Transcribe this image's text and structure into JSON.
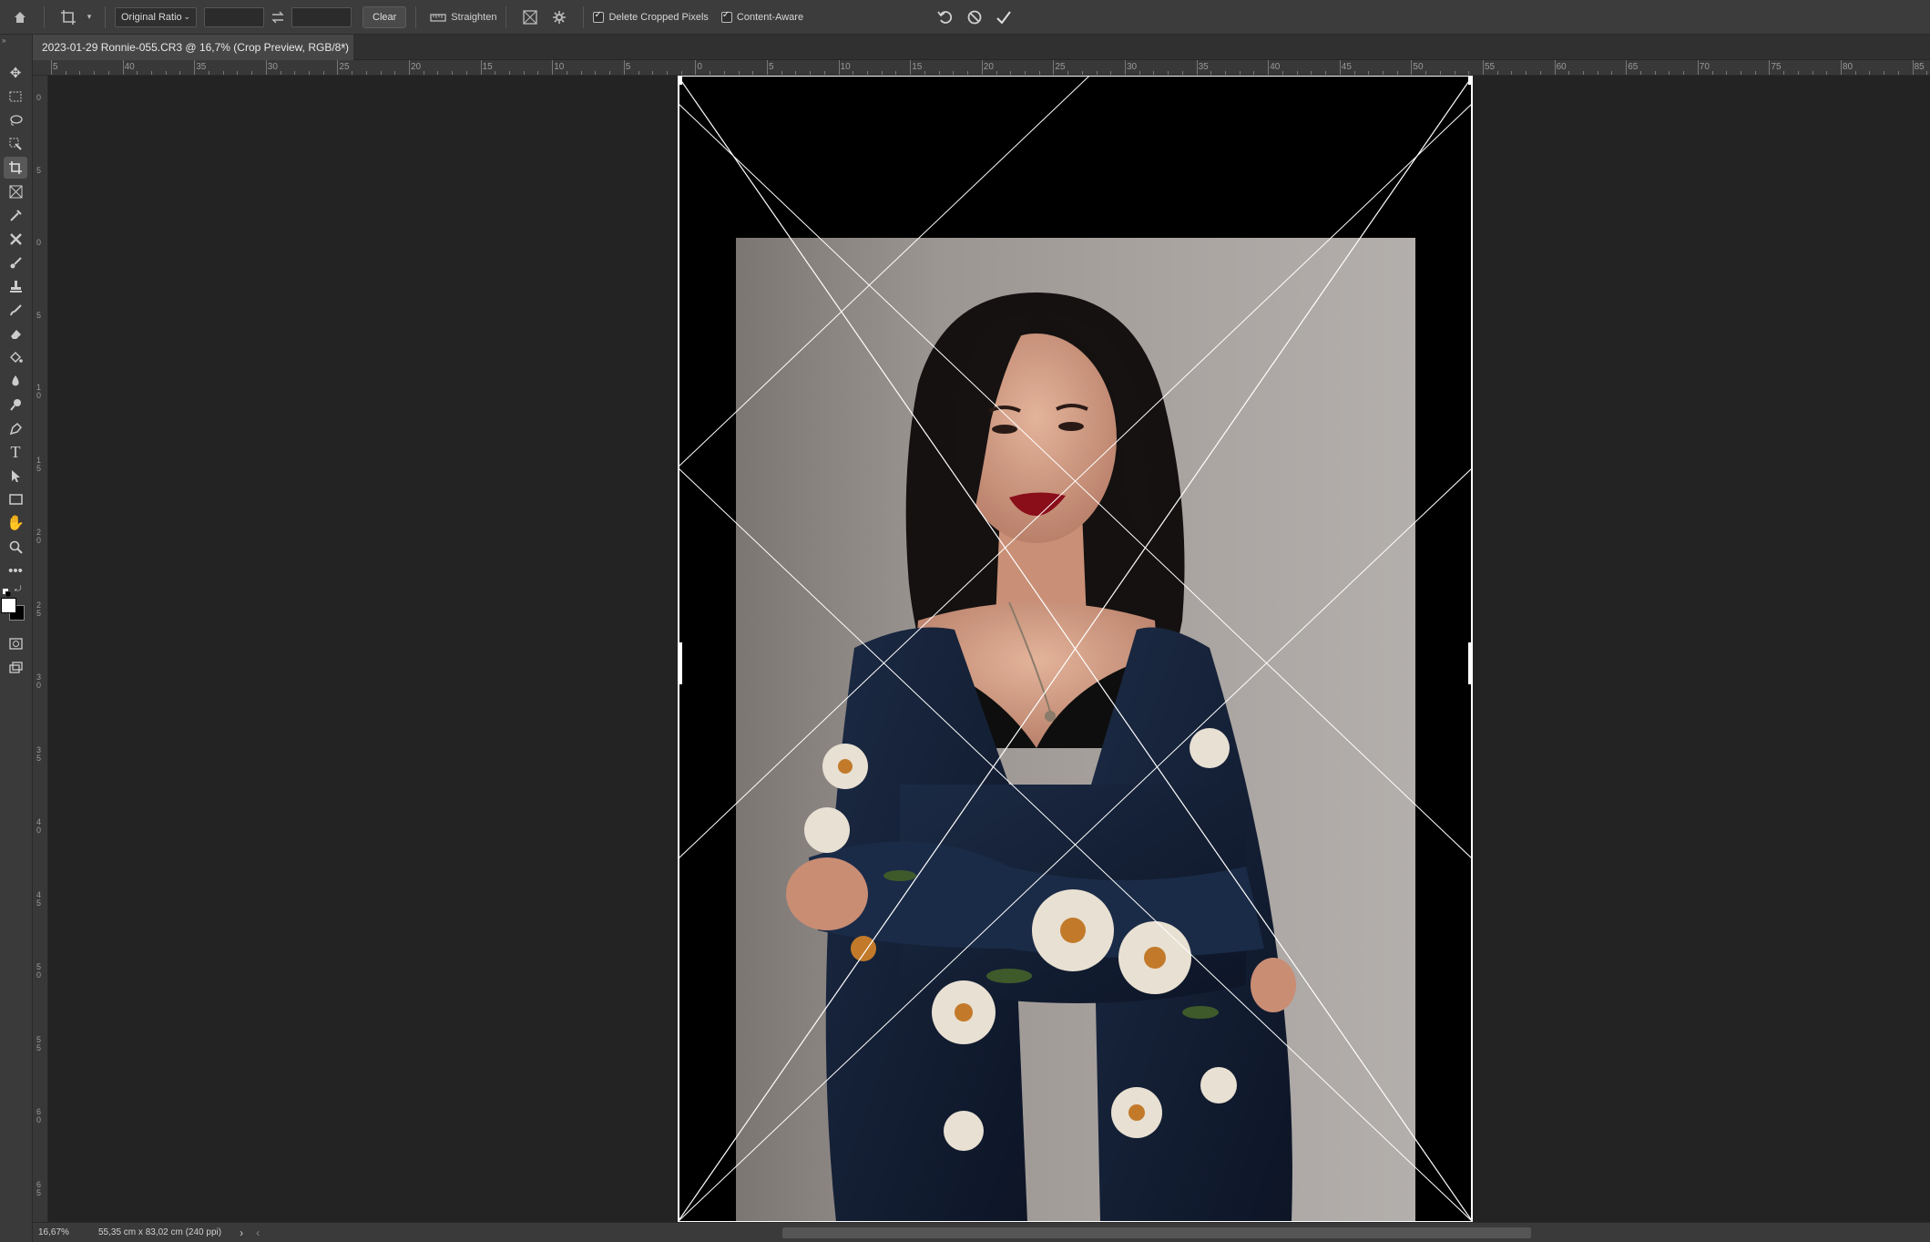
{
  "options_bar": {
    "ratio_preset": "Original Ratio",
    "width_value": "",
    "height_value": "",
    "clear_label": "Clear",
    "straighten_label": "Straighten",
    "delete_cropped_label": "Delete Cropped Pixels",
    "content_aware_label": "Content-Aware",
    "delete_cropped_checked": true,
    "content_aware_checked": true
  },
  "document_tab": {
    "title": "2023-01-29 Ronnie-055.CR3 @ 16,7% (Crop Preview, RGB/8*)",
    "close_glyph": "×"
  },
  "ruler_h": {
    "labels": [
      "5",
      "40",
      "35",
      "30",
      "25",
      "20",
      "15",
      "10",
      "5",
      "0",
      "5",
      "10",
      "15",
      "20",
      "25",
      "30",
      "35",
      "40",
      "45",
      "50",
      "55",
      "60",
      "65",
      "70",
      "75",
      "80",
      "85"
    ]
  },
  "ruler_v": {
    "labels": [
      "0",
      "5",
      "0",
      "5",
      "1 0",
      "1 5",
      "2 0",
      "2 5",
      "3 0",
      "3 5",
      "4 0",
      "4 5",
      "5 0",
      "5 5",
      "6 0",
      "6 5"
    ]
  },
  "status_bar": {
    "zoom": "16,67%",
    "doc_size": "55,35 cm x 83,02 cm (240 ppi)",
    "arrow": "›",
    "back_arrow": "‹"
  },
  "colors": {
    "foreground": "#ffffff",
    "background": "#000000"
  },
  "icons": {
    "home": "home-icon",
    "crop": "crop-icon",
    "swap": "swap-icon",
    "straighten": "straighten-icon",
    "overlay": "overlay-grid-icon",
    "settings": "gear-icon",
    "reset": "reset-icon",
    "cancel": "cancel-icon",
    "commit": "checkmark-icon"
  }
}
